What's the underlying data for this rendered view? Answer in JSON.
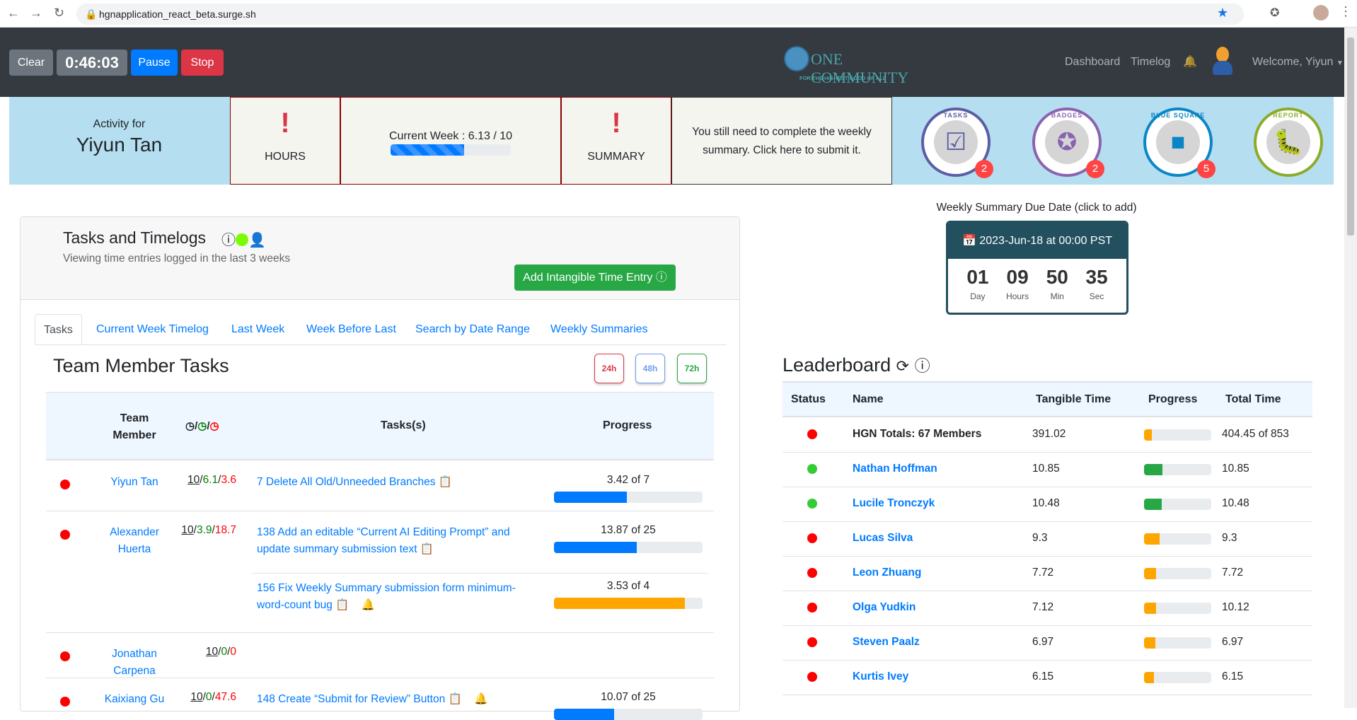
{
  "browser": {
    "url": "hgnapplication_react_beta.surge.sh"
  },
  "nav": {
    "clear": "Clear",
    "timer": "0:46:03",
    "pause": "Pause",
    "stop": "Stop",
    "logo_text": "ONE COMMUNITY",
    "logo_tagline": "FOR THE HIGHEST GOOD OF ALL",
    "dashboard": "Dashboard",
    "timelog": "Timelog",
    "welcome": "Welcome, Yiyun"
  },
  "banner": {
    "activity_for": "Activity for",
    "user": "Yiyun Tan",
    "hours_label": "HOURS",
    "alert": "!",
    "current_week": "Current Week : 6.13 / 10",
    "current_week_progress": 0.613,
    "summary_label": "SUMMARY",
    "summary_msg": "You still need to complete the weekly summary. Click here to submit it.",
    "badges": [
      {
        "label": "TASKS",
        "count": "2",
        "color": "#5b5ea6"
      },
      {
        "label": "BADGES",
        "count": "2",
        "color": "#8a63b0"
      },
      {
        "label": "BLUE SQUARE",
        "count": "5",
        "color": "#0a86c7"
      },
      {
        "label": "REPORT",
        "count": "",
        "color": "#8bac2a"
      }
    ]
  },
  "tasks_panel": {
    "title": "Tasks and Timelogs",
    "subtitle": "Viewing time entries logged in the last 3 weeks",
    "add_button": "Add Intangible Time Entry",
    "tabs": [
      "Tasks",
      "Current Week Timelog",
      "Last Week",
      "Week Before Last",
      "Search by Date Range",
      "Weekly Summaries"
    ],
    "heading": "Team Member Tasks",
    "filters": [
      "24h",
      "48h",
      "72h"
    ],
    "columns": {
      "member": "Team Member",
      "tasks": "Tasks(s)",
      "progress": "Progress"
    },
    "rows": [
      {
        "name": "Yiyun Tan",
        "committed": "10",
        "logged": "6.1",
        "total": "3.6",
        "tasks": [
          {
            "text": "7 Delete All Old/Unneeded Branches",
            "progress": "3.42 of 7",
            "value": 3.42,
            "max": 7,
            "color": "#007bff",
            "bell": false
          }
        ]
      },
      {
        "name": "Alexander Huerta",
        "committed": "10",
        "logged": "3.9",
        "total": "18.7",
        "tasks": [
          {
            "text": "138 Add an editable “Current AI Editing Prompt” and update summary submission text",
            "progress": "13.87 of 25",
            "value": 13.87,
            "max": 25,
            "color": "#007bff",
            "bell": false
          },
          {
            "text": "156 Fix Weekly Summary submission form minimum-word-count bug",
            "progress": "3.53 of 4",
            "value": 3.53,
            "max": 4,
            "color": "#ffa500",
            "bell": true
          }
        ]
      },
      {
        "name": "Jonathan Carpena",
        "committed": "10",
        "logged": "0",
        "total": "0",
        "tasks": []
      },
      {
        "name": "Kaixiang Gu",
        "committed": "10",
        "logged": "0",
        "total": "47.6",
        "tasks": [
          {
            "text": "148 Create “Submit for Review” Button",
            "progress": "10.07 of 25",
            "value": 10.07,
            "max": 25,
            "color": "#007bff",
            "bell": true
          }
        ]
      }
    ]
  },
  "due": {
    "label": "Weekly Summary Due Date (click to add)",
    "date": "2023-Jun-18 at 00:00 PST",
    "units": [
      {
        "v": "01",
        "l": "Day"
      },
      {
        "v": "09",
        "l": "Hours"
      },
      {
        "v": "50",
        "l": "Min"
      },
      {
        "v": "35",
        "l": "Sec"
      }
    ]
  },
  "leaderboard": {
    "title": "Leaderboard",
    "columns": [
      "Status",
      "Name",
      "Tangible Time",
      "Progress",
      "Total Time"
    ],
    "rows": [
      {
        "status": "red",
        "name": "HGN Totals: 67 Members",
        "tangible": "391.02",
        "progress": 0.12,
        "bar": "#ffa500",
        "total": "404.45 of 853",
        "link": false
      },
      {
        "status": "green",
        "name": "Nathan Hoffman",
        "tangible": "10.85",
        "progress": 0.27,
        "bar": "#28a745",
        "total": "10.85",
        "link": true
      },
      {
        "status": "green",
        "name": "Lucile Tronczyk",
        "tangible": "10.48",
        "progress": 0.26,
        "bar": "#28a745",
        "total": "10.48",
        "link": true
      },
      {
        "status": "red",
        "name": "Lucas Silva",
        "tangible": "9.3",
        "progress": 0.23,
        "bar": "#ffa500",
        "total": "9.3",
        "link": true
      },
      {
        "status": "red",
        "name": "Leon Zhuang",
        "tangible": "7.72",
        "progress": 0.18,
        "bar": "#ffa500",
        "total": "7.72",
        "link": true
      },
      {
        "status": "red",
        "name": "Olga Yudkin",
        "tangible": "7.12",
        "progress": 0.18,
        "bar": "#ffa500",
        "total": "10.12",
        "link": true
      },
      {
        "status": "red",
        "name": "Steven Paalz",
        "tangible": "6.97",
        "progress": 0.17,
        "bar": "#ffa500",
        "total": "6.97",
        "link": true
      },
      {
        "status": "red",
        "name": "Kurtis Ivey",
        "tangible": "6.15",
        "progress": 0.15,
        "bar": "#ffa500",
        "total": "6.15",
        "link": true
      }
    ]
  }
}
